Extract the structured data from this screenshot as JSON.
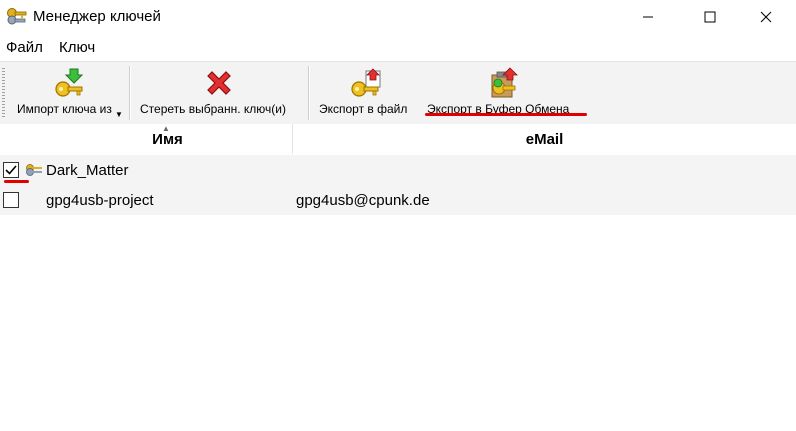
{
  "window": {
    "title": "Менеджер ключей"
  },
  "menu": [
    "Файл",
    "Ключ"
  ],
  "toolbar": {
    "import_label": "Импорт ключа из",
    "delete_label": "Стереть выбранн. ключ(и)",
    "export_file_label": "Экспорт в файл",
    "export_clipboard_label": "Экспорт в Буфер Обмена"
  },
  "columns": {
    "name": "Имя",
    "email": "eMail"
  },
  "keys": [
    {
      "name": "Dark_Matter",
      "email": "",
      "checked": true,
      "icon": "key-pair-icon"
    },
    {
      "name": "gpg4usb-project",
      "email": "gpg4usb@cpunk.de",
      "checked": false
    }
  ],
  "colors": {
    "highlight_underline": "#e00000",
    "toolbar_bg": "#f3f3f3",
    "row_bg": "#f4f4f4"
  }
}
